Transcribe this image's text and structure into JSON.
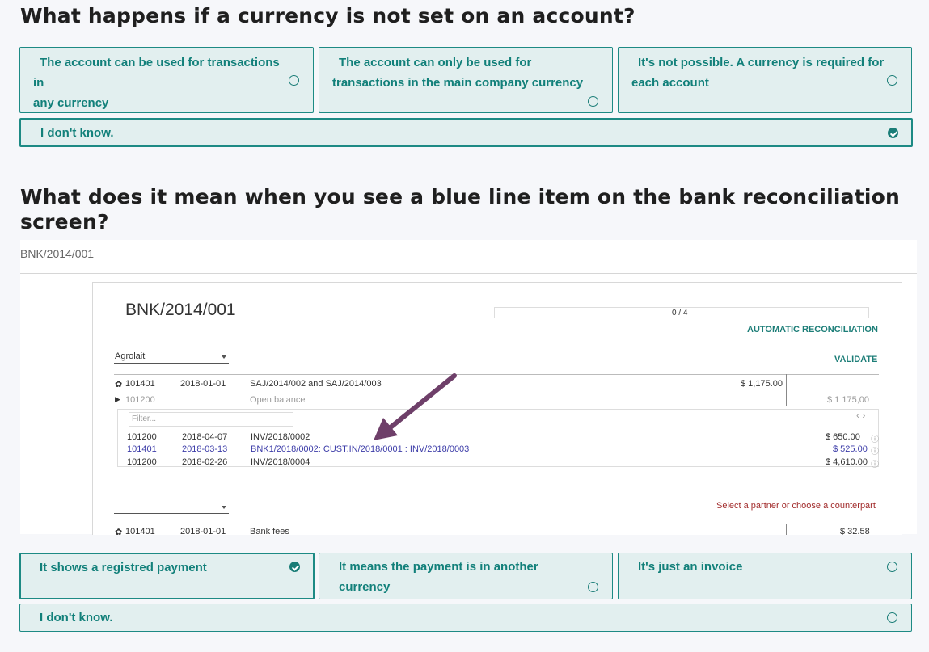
{
  "question1": {
    "title": "What happens if a currency is not set on an account?",
    "options": [
      {
        "line1": "The account can be used for transactions in",
        "line2": "any currency",
        "checked": false
      },
      {
        "line1": "The account can only be used for",
        "line2": "transactions in the main company currency",
        "checked": false
      },
      {
        "line1": "It's not possible. A currency is required for",
        "line2": "each account",
        "checked": false
      },
      {
        "line1": "I don't know.",
        "checked": true
      }
    ]
  },
  "question2": {
    "title_line1": "What does it mean when you see a blue line item on the bank reconciliation",
    "title_line2": "screen?",
    "image_caption": "BNK/2014/001",
    "options": [
      {
        "label": "It shows a registred payment",
        "checked": true
      },
      {
        "label": "It means the payment is in another currency",
        "checked": false
      },
      {
        "label": "It's just an invoice",
        "checked": false
      },
      {
        "label": "I don't know.",
        "checked": false
      }
    ]
  },
  "screenshot": {
    "title": "BNK/2014/001",
    "progress": "0 / 4",
    "auto_reconcile": "AUTOMATIC RECONCILIATION",
    "validate": "VALIDATE",
    "partner": "Agrolait",
    "row1": {
      "account": "101401",
      "date": "2018-01-01",
      "label": "SAJ/2014/002 and SAJ/2014/003",
      "amount": "$ 1,175.00"
    },
    "row2": {
      "account": "101200",
      "label": "Open balance",
      "amount": "$ 1 175,00"
    },
    "filter_placeholder": "Filter...",
    "lines": [
      {
        "account": "101200",
        "date": "2018-04-07",
        "label": "INV/2018/0002",
        "amount": "$ 650.00"
      },
      {
        "account": "101401",
        "date": "2018-03-13",
        "label": "BNK1/2018/0002: CUST.IN/2018/0001 : INV/2018/0003",
        "amount": "$ 525.00"
      },
      {
        "account": "101200",
        "date": "2018-02-26",
        "label": "INV/2018/0004",
        "amount": "$ 4,610.00"
      }
    ],
    "counterpart_hint": "Select a partner or choose a counterpart",
    "row3": {
      "account": "101401",
      "date": "2018-01-01",
      "label": "Bank fees",
      "amount": "$ 32.58"
    },
    "accent": "#1d7e78",
    "blue_line": "#3c3ca8",
    "arrow_color": "#6e3f69"
  }
}
